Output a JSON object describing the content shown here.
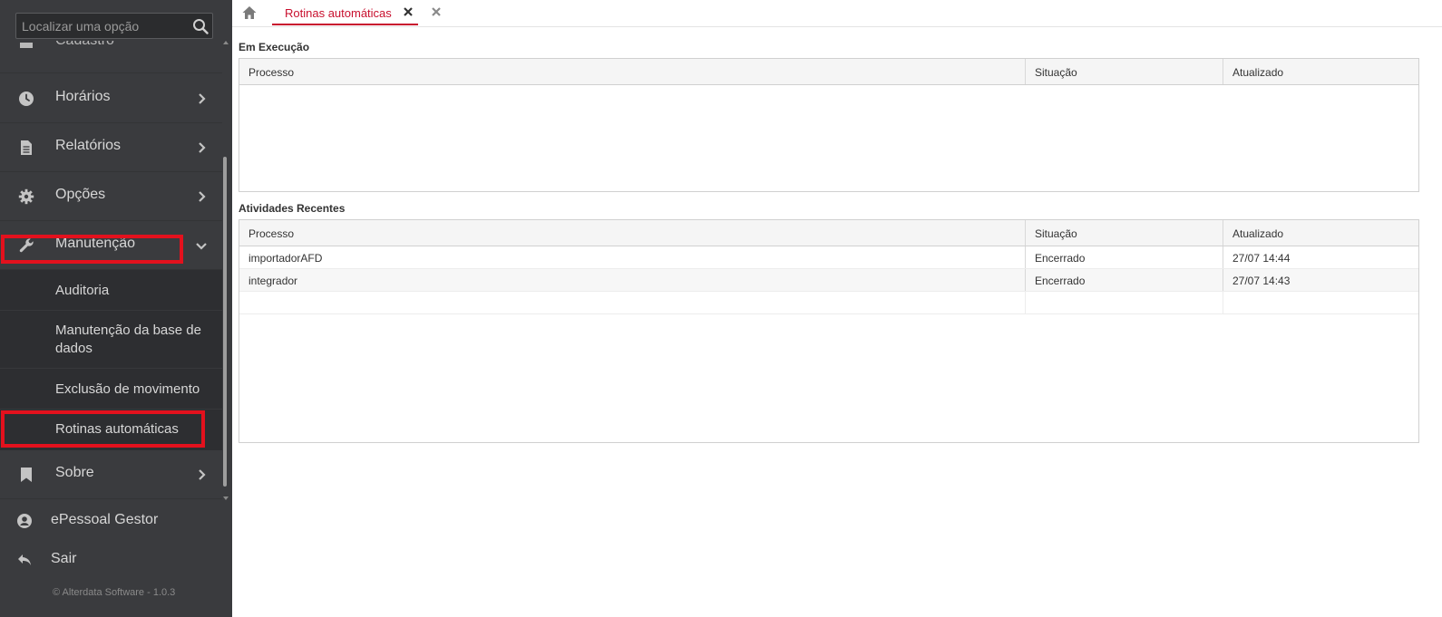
{
  "sidebar": {
    "search": {
      "placeholder": "Localizar uma opção"
    },
    "partial_item": {
      "label": "Cadastro"
    },
    "menu": [
      {
        "label": "Horários",
        "icon": "clock-icon"
      },
      {
        "label": "Relatórios",
        "icon": "document-icon"
      },
      {
        "label": "Opções",
        "icon": "gear-icon"
      },
      {
        "label": "Manutenção",
        "icon": "wrench-icon"
      },
      {
        "label": "Sobre",
        "icon": "bookmark-icon"
      }
    ],
    "submenu": [
      {
        "label": "Auditoria"
      },
      {
        "label": "Manutenção da base de dados"
      },
      {
        "label": "Exclusão de movimento"
      },
      {
        "label": "Rotinas automáticas"
      }
    ],
    "footer": [
      {
        "label": "ePessoal Gestor",
        "icon": "user-icon"
      },
      {
        "label": "Sair",
        "icon": "logout-icon"
      }
    ],
    "copyright": "© Alterdata Software - 1.0.3"
  },
  "tabs": {
    "active": {
      "label": "Rotinas automáticas"
    }
  },
  "running": {
    "title": "Em Execução",
    "columns": [
      "Processo",
      "Situação",
      "Atualizado"
    ],
    "rows": []
  },
  "recent": {
    "title": "Atividades Recentes",
    "columns": [
      "Processo",
      "Situação",
      "Atualizado"
    ],
    "rows": [
      {
        "processo": "importadorAFD",
        "situacao": "Encerrado",
        "atualizado": "27/07 14:44"
      },
      {
        "processo": "integrador",
        "situacao": "Encerrado",
        "atualizado": "27/07 14:43"
      }
    ]
  },
  "colors": {
    "sidebar_bg": "#3a3b3e",
    "submenu_bg": "#2d2e31",
    "accent_red": "#c8102e",
    "highlight_box": "#e3111d"
  }
}
